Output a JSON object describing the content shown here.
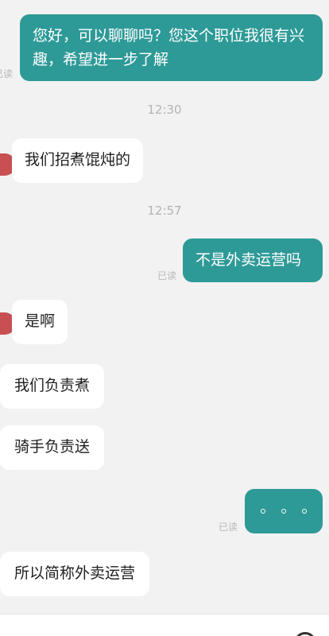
{
  "messages": [
    {
      "id": 1,
      "side": "sent",
      "text": "您好，可以聊聊吗？您这个职位我很有兴趣，希望进一步了解",
      "read_status": "已读"
    },
    {
      "id": 2,
      "side": "received",
      "text": "我们招煮馄炖的"
    },
    {
      "id": 3,
      "side": "sent",
      "text": "不是外卖运营吗",
      "read_status": "已读"
    },
    {
      "id": 4,
      "side": "received",
      "text": "是啊"
    },
    {
      "id": 5,
      "side": "received",
      "text": "我们负责煮"
    },
    {
      "id": 6,
      "side": "received",
      "text": "骑手负责送"
    },
    {
      "id": 7,
      "side": "sent",
      "text": "",
      "typing_indicator": true,
      "read_status": "已读"
    },
    {
      "id": 8,
      "side": "received",
      "text": "所以简称外卖运营"
    }
  ],
  "timestamps": [
    "12:30",
    "12:57"
  ],
  "colors": {
    "background": "#f2f2f2",
    "sent_bubble": "#2e9a97",
    "received_bubble": "#ffffff",
    "avatar": "#c95052"
  },
  "icons": {
    "avatar": "avatar-partial",
    "ellipsis": "ellipsis-icon",
    "bottom_action": "circle-action-icon"
  }
}
